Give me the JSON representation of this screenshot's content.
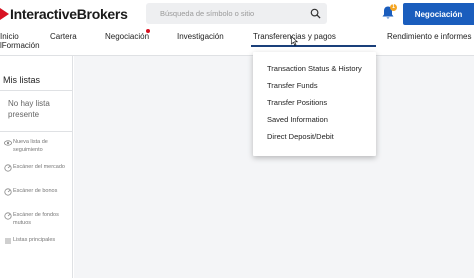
{
  "header": {
    "logo_text_part1": "Interactive",
    "logo_text_part2": "Brokers",
    "search_placeholder": "Búsqueda de símbolo o sitio",
    "notification_count": "1",
    "trade_button_label": "Negociación",
    "accent_color": "#1a5dbd",
    "brand_color": "#d81222"
  },
  "nav": {
    "items": [
      {
        "label": "Inicio"
      },
      {
        "label": "Cartera"
      },
      {
        "label": "Negociación"
      },
      {
        "label": "Investigación"
      },
      {
        "label": "Transferencias y pagos"
      },
      {
        "label": "Rendimiento e informes"
      }
    ],
    "sub_label": "lFormación",
    "active_item": "Transferencias y pagos"
  },
  "sidebar": {
    "title": "Mis listas",
    "empty_text": "No hay lista presente",
    "items": [
      {
        "label": "Nueva lista de seguimiento",
        "icon": "eye-icon"
      },
      {
        "label": "Escáner del mercado",
        "icon": "radar-icon"
      },
      {
        "label": "Escáner de bonos",
        "icon": "radar-icon"
      },
      {
        "label": "Escáner de fondos mutuos",
        "icon": "radar-icon"
      },
      {
        "label": "Listas principales",
        "icon": "list-icon"
      }
    ]
  },
  "dropdown": {
    "items": [
      {
        "label": "Transaction Status & History"
      },
      {
        "label": "Transfer Funds"
      },
      {
        "label": "Transfer Positions"
      },
      {
        "label": "Saved Information"
      },
      {
        "label": "Direct Deposit/Debit"
      }
    ]
  }
}
